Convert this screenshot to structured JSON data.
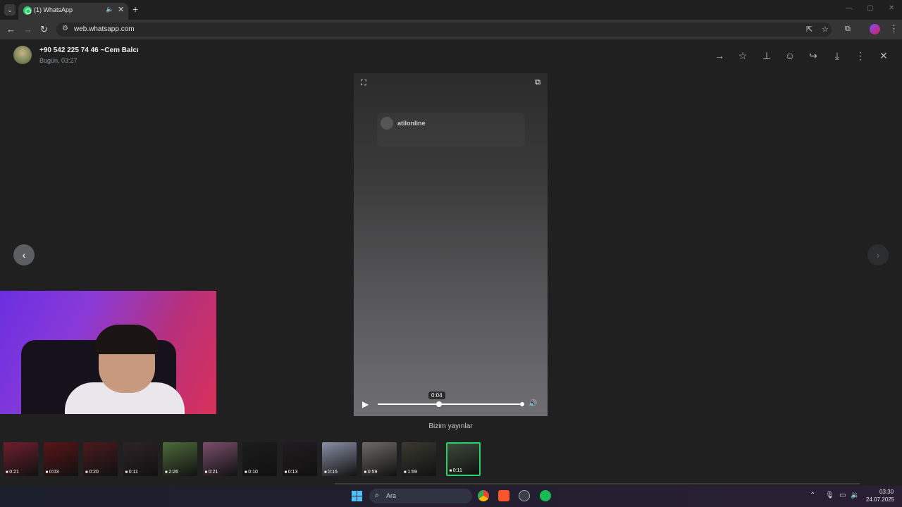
{
  "browser": {
    "tab_title": "(1) WhatsApp",
    "url": "web.whatsapp.com"
  },
  "viewer": {
    "contact": "+90 542 225 74 46 ~Cem Balcı",
    "timestamp": "Bugün, 03:27",
    "overlay_name": "atilonline",
    "current_time": "0:04",
    "progress_fraction": 0.42,
    "caption": "Bizim yayınlar"
  },
  "thumbnails": [
    {
      "duration": "0:21",
      "color": "#6e1f2e"
    },
    {
      "duration": "0:03",
      "color": "#5a1418"
    },
    {
      "duration": "0:20",
      "color": "#4a1a1e"
    },
    {
      "duration": "0:11",
      "color": "#2e2428"
    },
    {
      "duration": "2:26",
      "color": "#4d6a3a"
    },
    {
      "duration": "0:21",
      "color": "#7a4e6a"
    },
    {
      "duration": "0:10",
      "color": "#1c1c1c"
    },
    {
      "duration": "0:13",
      "color": "#221c20"
    },
    {
      "duration": "0:15",
      "color": "#8a8fa6"
    },
    {
      "duration": "0:59",
      "color": "#6d6a66"
    },
    {
      "duration": "1:59",
      "color": "#3a3a32"
    },
    {
      "duration": "0:11",
      "color": "#3b4a3a"
    }
  ],
  "taskbar": {
    "search_placeholder": "Ara",
    "time": "03:30",
    "date": "24.07.2025"
  },
  "colors": {
    "accent": "#25d366",
    "background": "#202020"
  }
}
